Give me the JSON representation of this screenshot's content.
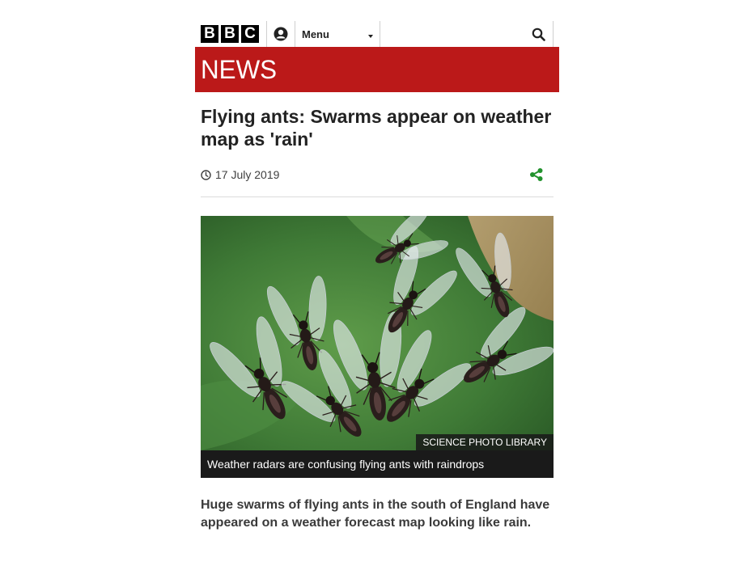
{
  "header": {
    "logo_letters": [
      "B",
      "B",
      "C"
    ],
    "menu_label": "Menu"
  },
  "banner": {
    "title": "NEWS",
    "color": "#bb1919"
  },
  "article": {
    "headline": "Flying ants: Swarms appear on weather map as 'rain'",
    "date": "17 July 2019",
    "image": {
      "credit": "SCIENCE PHOTO LIBRARY",
      "caption": "Weather radars are confusing flying ants with raindrops"
    },
    "intro": "Huge swarms of flying ants in the south of England have appeared on a weather forecast map looking like rain."
  },
  "icons": {
    "account": "user-icon",
    "search": "search-icon",
    "clock": "clock-icon",
    "share": "share-icon"
  },
  "colors": {
    "share_green": "#22922d"
  }
}
